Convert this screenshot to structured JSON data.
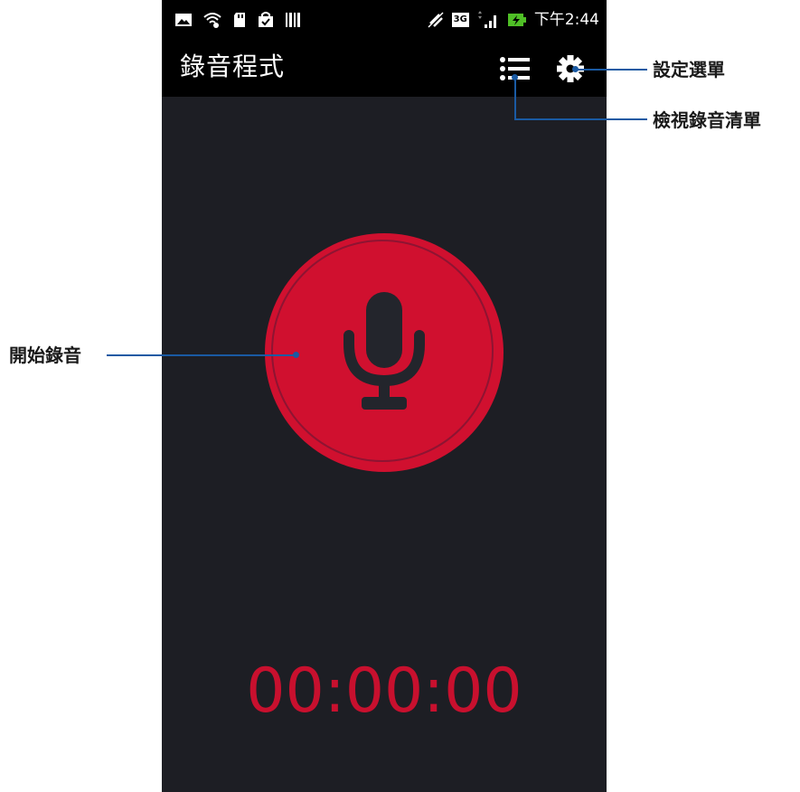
{
  "status_bar": {
    "time": "下午2:44",
    "network_type": "3G",
    "icons": [
      "image-icon",
      "wifi-icon",
      "sd-card-icon",
      "shopping-bag-icon",
      "barcode-icon",
      "no-sync-icon",
      "network-3g-icon",
      "signal-icon",
      "battery-charging-icon"
    ]
  },
  "app_bar": {
    "title": "錄音程式",
    "list_icon": "list-icon",
    "settings_icon": "gear-icon"
  },
  "main": {
    "record_icon": "microphone-icon",
    "timer": "00:00:00"
  },
  "callouts": {
    "settings_menu": "設定選單",
    "view_recordings": "檢視錄音清單",
    "start_recording": "開始錄音"
  },
  "colors": {
    "accent_red": "#d0102f",
    "background": "#1d1e24",
    "bar": "#000000",
    "callout_line": "#1a5aa3"
  }
}
